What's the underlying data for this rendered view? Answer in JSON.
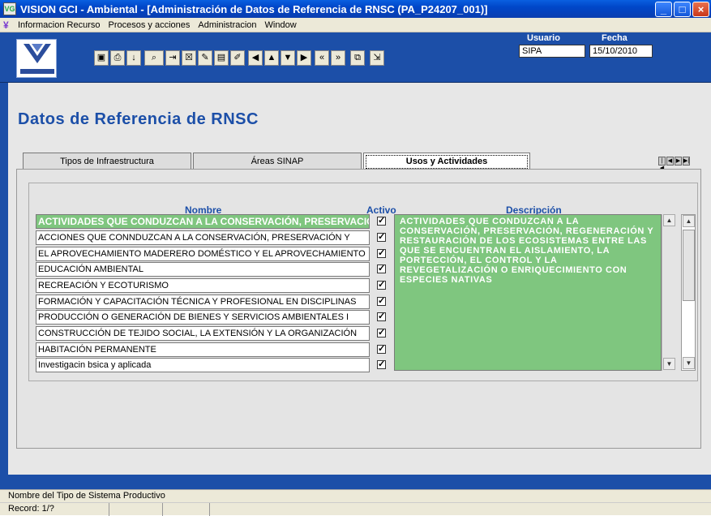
{
  "window": {
    "title": "VISION GCI - Ambiental - [Administración de Datos de Referencia de RNSC  (PA_P24207_001)]",
    "icon_text": "VG"
  },
  "menu": [
    "Informacion Recurso",
    "Procesos y acciones",
    "Administracion",
    "Window"
  ],
  "header": {
    "usuario_label": "Usuario",
    "usuario_value": "SIPA",
    "fecha_label": "Fecha",
    "fecha_value": "15/10/2010"
  },
  "page": {
    "title": "Datos de Referencia de RNSC"
  },
  "tabs": [
    {
      "label": "Tipos de Infraestructura"
    },
    {
      "label": "Áreas SINAP"
    },
    {
      "label": "Usos y Actividades",
      "active": true
    }
  ],
  "grid": {
    "col_nombre": "Nombre",
    "col_activo": "Activo",
    "col_descripcion": "Descripción",
    "rows": [
      {
        "nombre": "ACTIVIDADES QUE CONDUZCAN A LA CONSERVACIÓN, PRESERVACIÓN",
        "activo": true
      },
      {
        "nombre": "ACCIONES QUE CONNDUZCAN A LA CONSERVACIÓN, PRESERVACIÓN Y",
        "activo": true
      },
      {
        "nombre": "EL APROVECHAMIENTO MADERERO DOMÉSTICO Y EL APROVECHAMIENTO",
        "activo": true
      },
      {
        "nombre": "EDUCACIÓN AMBIENTAL",
        "activo": true
      },
      {
        "nombre": "RECREACIÓN Y ECOTURISMO",
        "activo": true
      },
      {
        "nombre": "FORMACIÓN Y CAPACITACIÓN TÉCNICA Y PROFESIONAL EN DISCIPLINAS",
        "activo": true
      },
      {
        "nombre": "PRODUCCIÓN O GENERACIÓN DE BIENES Y SERVICIOS AMBIENTALES I",
        "activo": true
      },
      {
        "nombre": "CONSTRUCCIÓN DE TEJIDO SOCIAL, LA EXTENSIÓN Y LA ORGANIZACIÓN",
        "activo": true
      },
      {
        "nombre": "HABITACIÓN PERMANENTE",
        "activo": true
      },
      {
        "nombre": "Investigacin bsica y aplicada",
        "activo": true
      }
    ],
    "description": "ACTIVIDADES QUE CONDUZCAN A LA CONSERVACIÓN, PRESERVACIÓN, REGENERACIÓN Y RESTAURACIÓN DE LOS ECOSISTEMAS ENTRE LAS QUE SE ENCUENTRAN EL AISLAMIENTO, LA PORTECCIÓN, EL CONTROL Y LA REVEGETALIZACIÓN O ENRIQUECIMIENTO CON ESPECIES NATIVAS"
  },
  "status": {
    "hint": "Nombre del Tipo de Sistema Productivo",
    "record": "Record: 1/?"
  }
}
